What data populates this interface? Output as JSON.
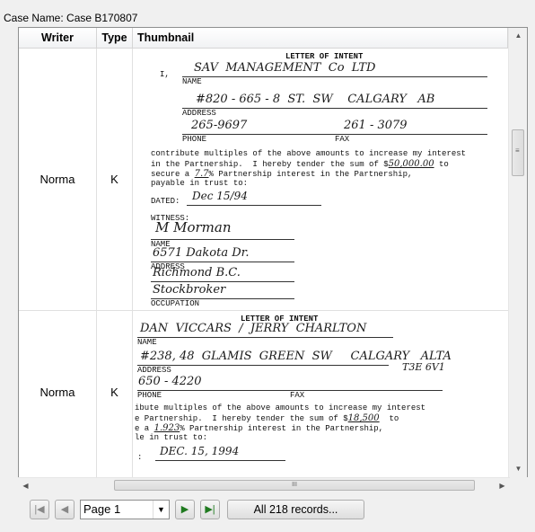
{
  "case": {
    "name_label": "Case Name: Case B170807"
  },
  "columns": [
    "Writer",
    "Type",
    "Thumbnail"
  ],
  "rows": [
    {
      "writer": "Norma",
      "type": "K",
      "doc": {
        "heading": "LETTER OF INTENT",
        "i_label": "I,",
        "name_hw": "SAV  MANAGEMENT  Co  LTD",
        "name_label": "NAME",
        "address_hw": "#820 - 665 - 8  ST.  SW    CALGARY   AB",
        "address_label": "ADDRESS",
        "phone_hw": "265-9697",
        "fax_hw": "261 - 3079",
        "phone_label": "PHONE",
        "fax_label": "FAX",
        "body1": "contribute multiples of the above amounts to increase my interest",
        "body2": "in the Partnership.  I hereby tender the sum of $",
        "amount_hw": "50,000.00",
        "body2_end": " to",
        "body3": "secure a",
        "percent_hw": "7.7",
        "body3_end": "% Partnership interest in the Partnership,",
        "body4": "payable in trust to:",
        "dated_label": "DATED:",
        "dated_hw": "Dec 15/94",
        "witness_label": "WITNESS:",
        "w_name_hw": "M Morman",
        "w_name_label": "NAME",
        "w_addr_hw": "6571 Dakota Dr.",
        "w_addr_label": "ADDRESS",
        "w_addr2_hw": "Richmond B.C.",
        "w_occ_hw": "Stockbroker",
        "w_occ_label": "OCCUPATION"
      }
    },
    {
      "writer": "Norma",
      "type": "K",
      "doc": {
        "heading": "LETTER OF INTENT",
        "name_hw": "DAN  VICCARS  /  JERRY  CHARLTON",
        "name_label": "NAME",
        "address_hw": "#238, 48  GLAMIS  GREEN  SW     CALGARY   ALTA",
        "postal_hw": "T3E 6V1",
        "address_label": "ADDRESS",
        "phone_hw": "650 - 4220",
        "phone_label": "PHONE",
        "fax_label": "FAX",
        "body1": "ibute multiples of the above amounts to increase my interest",
        "body2": "e Partnership.  I hereby tender the sum of $",
        "amount_hw": "18,500",
        "body2_end": "  to",
        "body3": "e a",
        "percent_hw": "1.923",
        "body3_end": "% Partnership interest in the Partnership,",
        "body4": "le in trust to:",
        "dated_prefix": ":",
        "dated_hw": "DEC. 15, 1994"
      }
    }
  ],
  "scroll": {
    "h_thumb_grip": "III",
    "v_thumb_grip": "≡"
  },
  "pager": {
    "first_icon": "|◀",
    "prev_icon": "◀",
    "page_value": "Page 1",
    "dropdown_icon": "▼",
    "next_icon": "▶",
    "last_icon": "▶|",
    "records_label": "All 218 records..."
  },
  "colors": {
    "accent_green": "#1f7a1f",
    "grid_border": "#8e8f8f"
  }
}
